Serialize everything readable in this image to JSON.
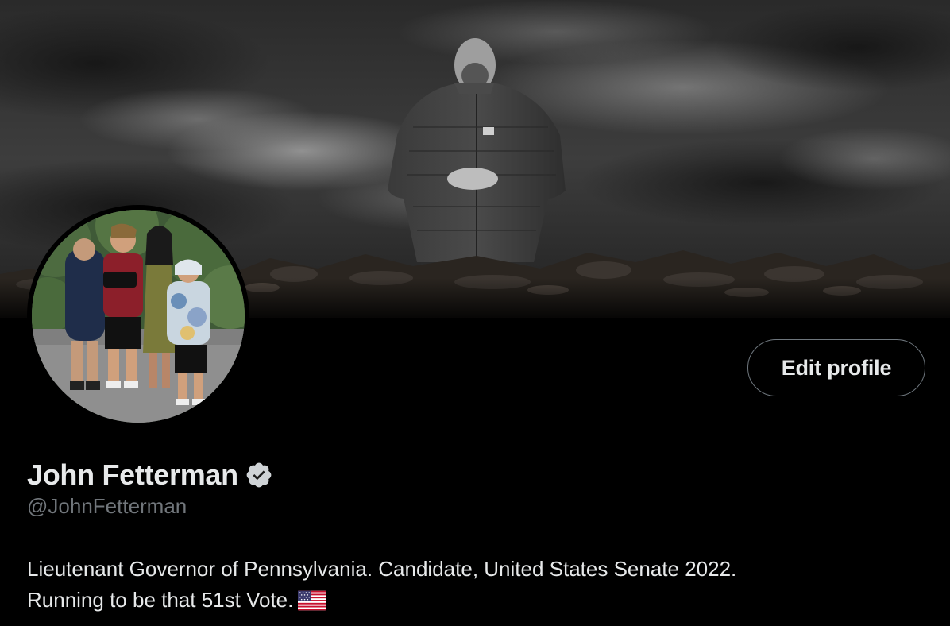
{
  "profile": {
    "display_name": "John Fetterman",
    "handle": "@JohnFetterman",
    "verified_icon": "verified-badge-icon",
    "bio_line1": "Lieutenant Governor of Pennsylvania. Candidate, United States Senate 2022.",
    "bio_line2": "Running to be that 51st Vote.",
    "bio_emoji": "us-flag-icon"
  },
  "actions": {
    "edit_profile_label": "Edit profile"
  },
  "colors": {
    "background": "#000000",
    "text_primary": "#e7e9ea",
    "text_secondary": "#71767b",
    "button_border": "#6e767d"
  }
}
